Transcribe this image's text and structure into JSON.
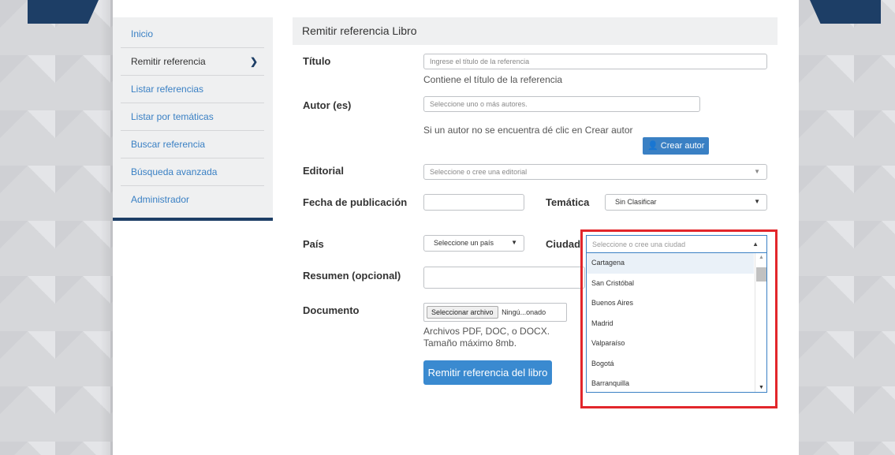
{
  "sidebar": {
    "items": [
      {
        "label": "Inicio"
      },
      {
        "label": "Remitir referencia"
      },
      {
        "label": "Listar referencias"
      },
      {
        "label": "Listar por temáticas"
      },
      {
        "label": "Buscar referencia"
      },
      {
        "label": "Búsqueda avanzada"
      },
      {
        "label": "Administrador"
      }
    ]
  },
  "panel": {
    "title": "Remitir referencia Libro"
  },
  "form": {
    "titulo": {
      "label": "Título",
      "placeholder": "Ingrese el título de la referencia",
      "help": "Contiene el título de la referencia"
    },
    "autor": {
      "label": "Autor (es)",
      "placeholder": "Seleccione uno o más autores.",
      "help": "Si un autor no se encuentra dé clic en Crear autor",
      "create_button": "Crear autor"
    },
    "editorial": {
      "label": "Editorial",
      "placeholder": "Seleccione o cree una editorial"
    },
    "fecha": {
      "label": "Fecha de publicación",
      "value": ""
    },
    "tematica": {
      "label": "Temática",
      "selected": "Sin Clasificar"
    },
    "pais": {
      "label": "País",
      "selected": "Seleccione un país"
    },
    "ciudad": {
      "label": "Ciudad",
      "placeholder": "Seleccione o cree una ciudad",
      "options": [
        "Cartagena",
        "San Cristóbal",
        "Buenos Aires",
        "Madrid",
        "Valparaíso",
        "Bogotá",
        "Barranquilla"
      ]
    },
    "resumen": {
      "label": "Resumen (opcional)"
    },
    "documento": {
      "label": "Documento",
      "file_button": "Seleccionar archivo",
      "file_status": "Ningú...onado",
      "help_line1": "Archivos PDF, DOC, o DOCX.",
      "help_line2": "Tamaño máximo 8mb."
    },
    "submit": "Remitir referencia del libro"
  },
  "colors": {
    "accent": "#3a80c4",
    "highlight": "#e2262b",
    "navy": "#1d3e66"
  }
}
